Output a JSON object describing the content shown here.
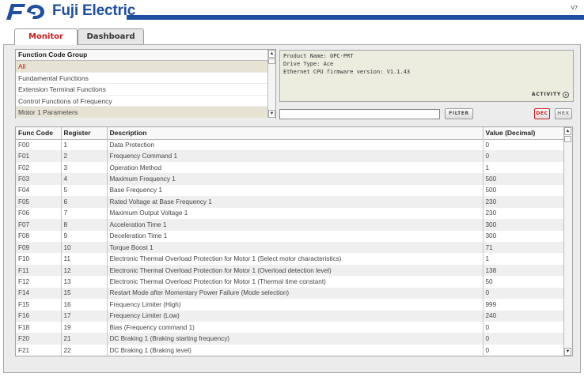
{
  "header": {
    "brand": "Fuji Electric",
    "version": "V7",
    "brand_color": "#1e4fa0",
    "accent_color": "#c51c1c"
  },
  "tabs": [
    {
      "label": "Monitor",
      "active": true
    },
    {
      "label": "Dashboard",
      "active": false
    }
  ],
  "function_code_group": {
    "header": "Function Code Group",
    "items": [
      "All",
      "Fundamental Functions",
      "Extension Terminal Functions",
      "Control Functions of Frequency",
      "Motor 1 Parameters"
    ],
    "selected": "All"
  },
  "info": {
    "product_name": "Product Name: OPC-PRT",
    "drive_type": "Drive Type: Ace",
    "firmware": "Ethernet CPU firmware version: V1.1.43",
    "activity_label": "ACTIVITY"
  },
  "filter": {
    "value": "",
    "button_label": "FILTER"
  },
  "format": {
    "dec_label": "DEC",
    "hex_label": "HEX",
    "selected": "DEC"
  },
  "table": {
    "columns": [
      "Func Code",
      "Register",
      "Description",
      "Value (Decimal)"
    ],
    "rows": [
      [
        "F00",
        "1",
        "Data Protection",
        "0"
      ],
      [
        "F01",
        "2",
        "Frequency Command 1",
        "0"
      ],
      [
        "F02",
        "3",
        "Operation Method",
        "1"
      ],
      [
        "F03",
        "4",
        "Maximum Frequency 1",
        "500"
      ],
      [
        "F04",
        "5",
        "Base Frequency 1",
        "500"
      ],
      [
        "F05",
        "6",
        "Rated Voltage at Base Frequency 1",
        "230"
      ],
      [
        "F06",
        "7",
        "Maximum Output Voltage 1",
        "230"
      ],
      [
        "F07",
        "8",
        "Acceleration Time 1",
        "300"
      ],
      [
        "F08",
        "9",
        "Deceleration Time 1",
        "300"
      ],
      [
        "F09",
        "10",
        "Torque Boost 1",
        "71"
      ],
      [
        "F10",
        "11",
        "Electronic Thermal Overload Protection for Motor 1 (Select motor characteristics)",
        "1"
      ],
      [
        "F11",
        "12",
        "Electronic Thermal Overload Protection for Motor 1 (Overload detection level)",
        "138"
      ],
      [
        "F12",
        "13",
        "Electronic Thermal Overload Protection for Motor 1 (Thermal time constant)",
        "50"
      ],
      [
        "F14",
        "15",
        "Restart Mode after Momentary Power Failure (Mode selection)",
        "0"
      ],
      [
        "F15",
        "16",
        "Frequency Limiter (High)",
        "999"
      ],
      [
        "F16",
        "17",
        "Frequency Limiter (Low)",
        "240"
      ],
      [
        "F18",
        "19",
        "Bias (Frequency command 1)",
        "0"
      ],
      [
        "F20",
        "21",
        "DC Braking 1 (Braking starting frequency)",
        "0"
      ],
      [
        "F21",
        "22",
        "DC Braking 1 (Braking level)",
        "0"
      ]
    ]
  },
  "icons": {
    "scroll_up": "scroll-up-arrow-icon",
    "scroll_down": "scroll-down-arrow-icon",
    "activity": "activity-indicator-icon"
  }
}
